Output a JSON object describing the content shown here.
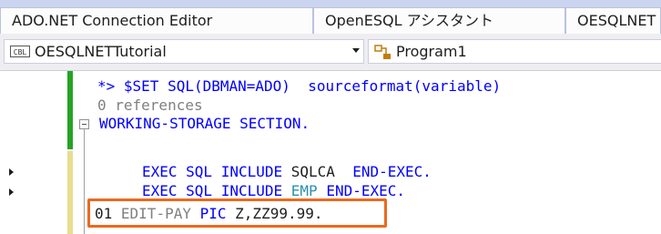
{
  "tabs": [
    {
      "label": "ADO.NET Connection Editor",
      "active": false
    },
    {
      "label": "OpenESQL アシスタント",
      "active": false
    },
    {
      "label": "OESQLNET",
      "active": false
    }
  ],
  "navbar": {
    "project_icon_text": "CBL",
    "project": "OESQLNETTutorial",
    "member": "Program1"
  },
  "editor": {
    "line1": {
      "prefix": "*> ",
      "text": "$SET SQL(DBMAN=ADO)  sourceformat(variable)"
    },
    "codelens": "0 references",
    "line3": "WORKING-STORAGE SECTION.",
    "line4": {
      "kw1": "EXEC SQL INCLUDE",
      "name": "SQLCA",
      "kw2": "END-EXEC."
    },
    "line5": {
      "kw1": "EXEC SQL INCLUDE",
      "name": "EMP",
      "kw2": "END-EXEC."
    },
    "line6": {
      "level": "01",
      "name": "EDIT-PAY",
      "kw": "PIC",
      "pic": "Z,ZZ99.99."
    }
  },
  "colors": {
    "keyword": "#0000ff",
    "highlight_border": "#ea6a1e",
    "change_saved": "#26a326",
    "change_unsaved": "#e9dd8e"
  }
}
